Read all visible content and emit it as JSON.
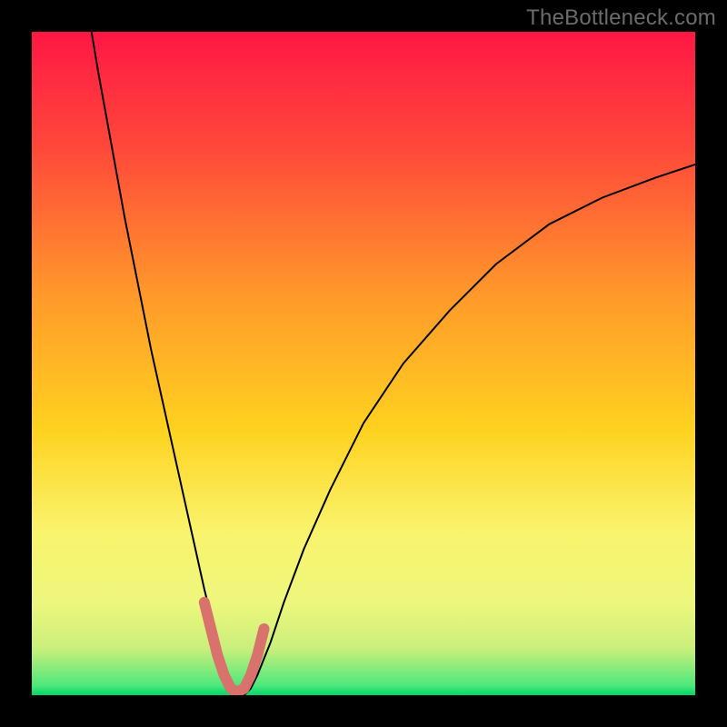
{
  "watermark": "TheBottleneck.com",
  "chart_data": {
    "type": "line",
    "title": "",
    "xlabel": "",
    "ylabel": "",
    "xlim": [
      0,
      100
    ],
    "ylim": [
      0,
      100
    ],
    "grid": false,
    "legend": false,
    "background_gradient": [
      {
        "pos": 0.0,
        "color": "#ff1744"
      },
      {
        "pos": 0.18,
        "color": "#ff4a3a"
      },
      {
        "pos": 0.4,
        "color": "#ff9a2a"
      },
      {
        "pos": 0.6,
        "color": "#ffd21f"
      },
      {
        "pos": 0.75,
        "color": "#f9f36b"
      },
      {
        "pos": 0.86,
        "color": "#eef77d"
      },
      {
        "pos": 0.93,
        "color": "#c9ef7b"
      },
      {
        "pos": 0.985,
        "color": "#4fe87c"
      },
      {
        "pos": 1.0,
        "color": "#00d868"
      }
    ],
    "series": [
      {
        "name": "bottleneck-curve",
        "color": "#000000",
        "width": 2,
        "x": [
          9,
          10,
          12,
          14,
          16,
          18,
          20,
          22,
          24,
          26,
          27,
          28,
          29,
          30,
          31,
          32,
          33,
          34,
          36,
          38,
          41,
          45,
          50,
          56,
          63,
          70,
          78,
          86,
          94,
          100
        ],
        "y": [
          100,
          94,
          83,
          72,
          62,
          52,
          43,
          34,
          25,
          16,
          12,
          8,
          4,
          1,
          0,
          0,
          1,
          3,
          8,
          14,
          22,
          31,
          41,
          50,
          58,
          65,
          71,
          75,
          78,
          80
        ]
      },
      {
        "name": "optimal-zone-highlight",
        "color": "#d9716d",
        "width": 12,
        "linecap": "round",
        "x": [
          26,
          27,
          28,
          29,
          30,
          31,
          32,
          33,
          34,
          35
        ],
        "y": [
          14,
          10,
          6,
          3,
          1,
          0.5,
          1,
          3,
          6,
          10
        ]
      }
    ]
  }
}
